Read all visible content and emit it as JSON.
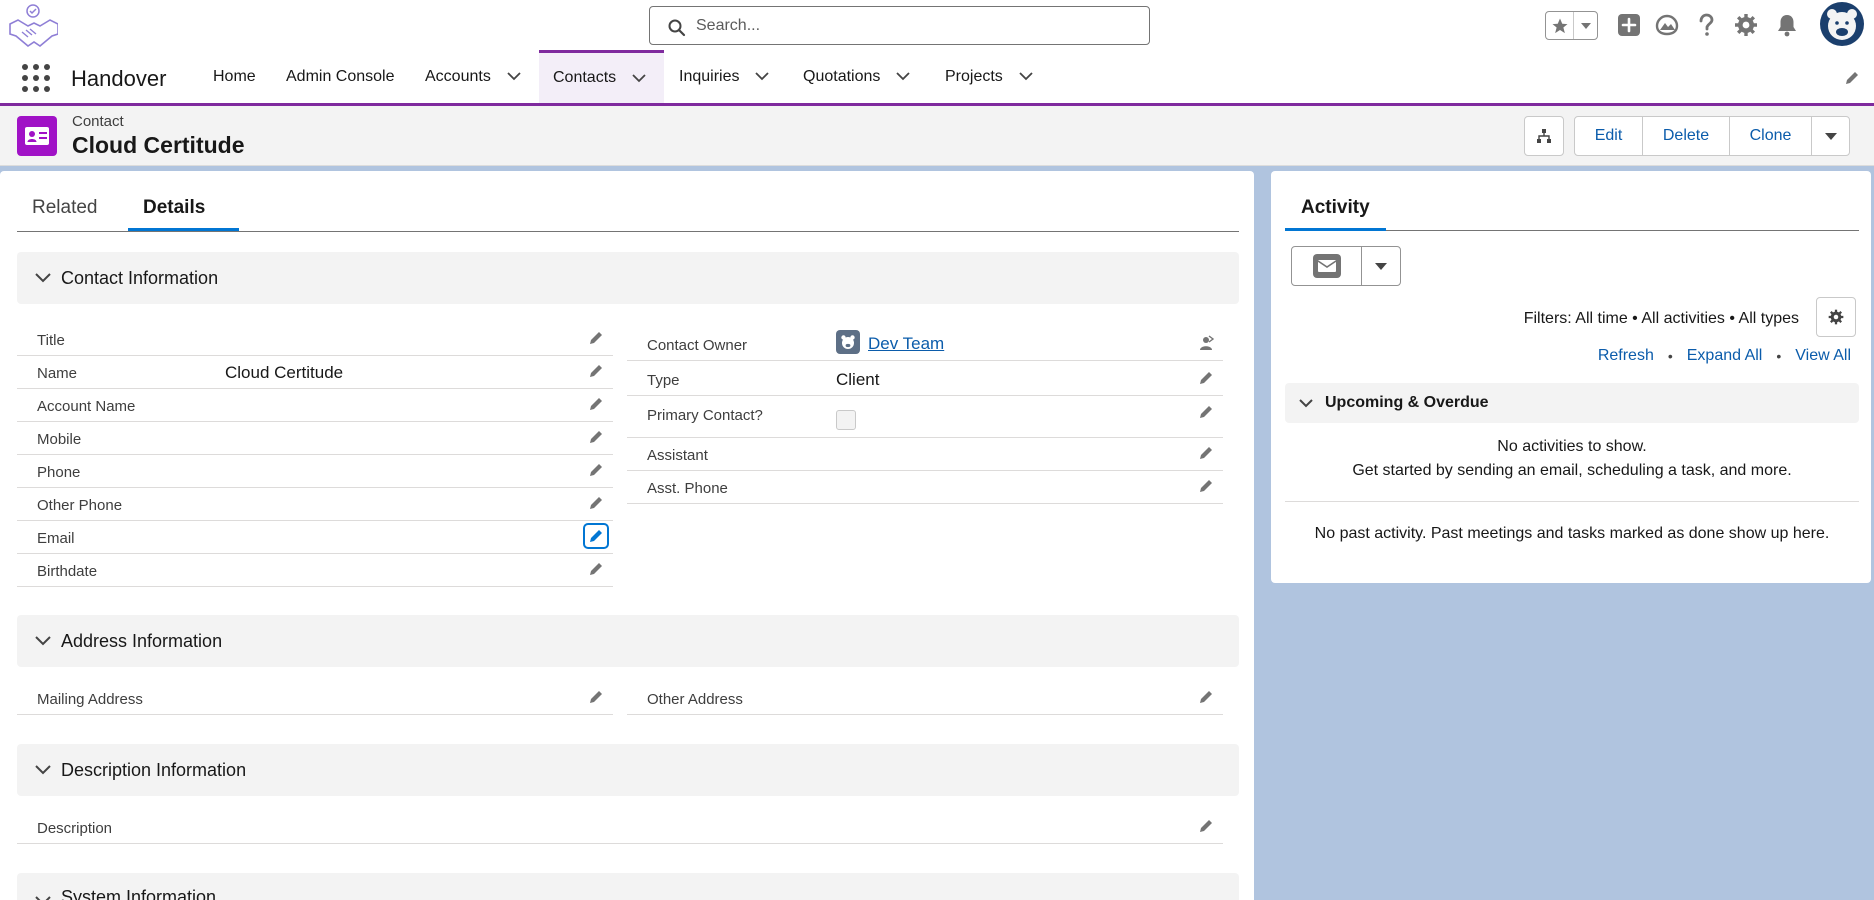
{
  "search": {
    "placeholder": "Search..."
  },
  "app": {
    "name": "Handover"
  },
  "nav": {
    "items": [
      {
        "label": "Home"
      },
      {
        "label": "Admin Console"
      },
      {
        "label": "Accounts"
      },
      {
        "label": "Contacts"
      },
      {
        "label": "Inquiries"
      },
      {
        "label": "Quotations"
      },
      {
        "label": "Projects"
      }
    ],
    "active": "Contacts"
  },
  "record": {
    "type": "Contact",
    "title": "Cloud Certitude",
    "actions": [
      "Edit",
      "Delete",
      "Clone"
    ]
  },
  "tabs": {
    "related": "Related",
    "details": "Details"
  },
  "sections": {
    "contact": "Contact Information",
    "address": "Address Information",
    "description": "Description Information",
    "system": "System Information"
  },
  "fields_left": [
    {
      "label": "Title",
      "value": ""
    },
    {
      "label": "Name",
      "value": "Cloud Certitude"
    },
    {
      "label": "Account Name",
      "value": ""
    },
    {
      "label": "Mobile",
      "value": ""
    },
    {
      "label": "Phone",
      "value": ""
    },
    {
      "label": "Other Phone",
      "value": ""
    },
    {
      "label": "Email",
      "value": ""
    },
    {
      "label": "Birthdate",
      "value": ""
    }
  ],
  "fields_right": {
    "owner": {
      "label": "Contact Owner",
      "value": "Dev Team"
    },
    "type": {
      "label": "Type",
      "value": "Client"
    },
    "primary": {
      "label": "Primary Contact?",
      "checked": false
    },
    "assistant": {
      "label": "Assistant",
      "value": ""
    },
    "asst_phone": {
      "label": "Asst. Phone",
      "value": ""
    }
  },
  "address": {
    "mailing": {
      "label": "Mailing Address",
      "value": ""
    },
    "other": {
      "label": "Other Address",
      "value": ""
    }
  },
  "description": {
    "label": "Description",
    "value": ""
  },
  "activity": {
    "tab": "Activity",
    "filters": "Filters: All time • All activities • All types",
    "links": [
      "Refresh",
      "Expand All",
      "View All"
    ],
    "upcoming": "Upcoming & Overdue",
    "no_activities_1": "No activities to show.",
    "no_activities_2": "Get started by sending an email, scheduling a task, and more.",
    "no_past": "No past activity. Past meetings and tasks marked as done show up here."
  },
  "colors": {
    "brand_purple": "#7f2a9e",
    "record_icon": "#a012c6",
    "link_blue": "#0b5cab",
    "accent_blue": "#0176d3",
    "background": "#b0c4df"
  },
  "icons": {
    "logo": "handshake-logo-icon",
    "favorites": "star-icon",
    "add": "plus-icon",
    "trailhead": "trailhead-icon",
    "help": "question-icon",
    "setup": "gear-icon",
    "notifications": "bell-icon",
    "avatar": "bear-avatar"
  }
}
